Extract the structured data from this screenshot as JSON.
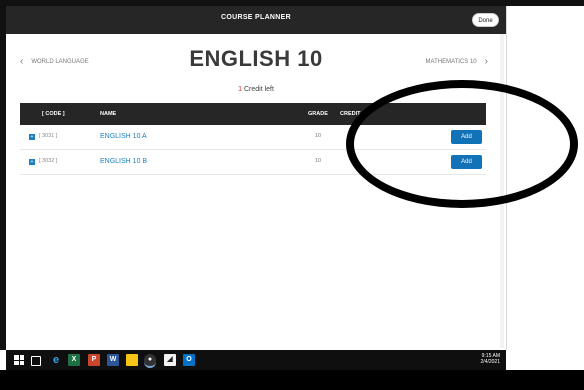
{
  "header": {
    "title": "COURSE PLANNER",
    "done_label": "Done"
  },
  "nav": {
    "prev_label": "WORLD LANGUAGE",
    "next_label": "MATHEMATICS 10"
  },
  "course": {
    "title": "ENGLISH 10",
    "credits_num": "1",
    "credits_text": "Credit left"
  },
  "table": {
    "headers": {
      "code": "[ CODE ]",
      "name": "NAME",
      "grade": "GRADE",
      "credits": "CREDIT"
    },
    "rows": [
      {
        "code": "[ 3031 ]",
        "name": "ENGLISH 10 A",
        "grade": "10",
        "action": "Add"
      },
      {
        "code": "[ 3032 ]",
        "name": "ENGLISH 10 B",
        "grade": "10",
        "action": "Add"
      }
    ]
  },
  "taskbar": {
    "time": "9:15 AM",
    "date": "2/4/2021",
    "icons": [
      "task-view-icon",
      "edge-icon",
      "excel-icon",
      "powerpoint-icon",
      "word-icon",
      "file-explorer-icon",
      "chrome-icon",
      "app-icon",
      "outlook-icon"
    ]
  },
  "colors": {
    "accent": "#1c7fc0",
    "header_bg": "#262626",
    "credit_num": "#d9262f"
  }
}
